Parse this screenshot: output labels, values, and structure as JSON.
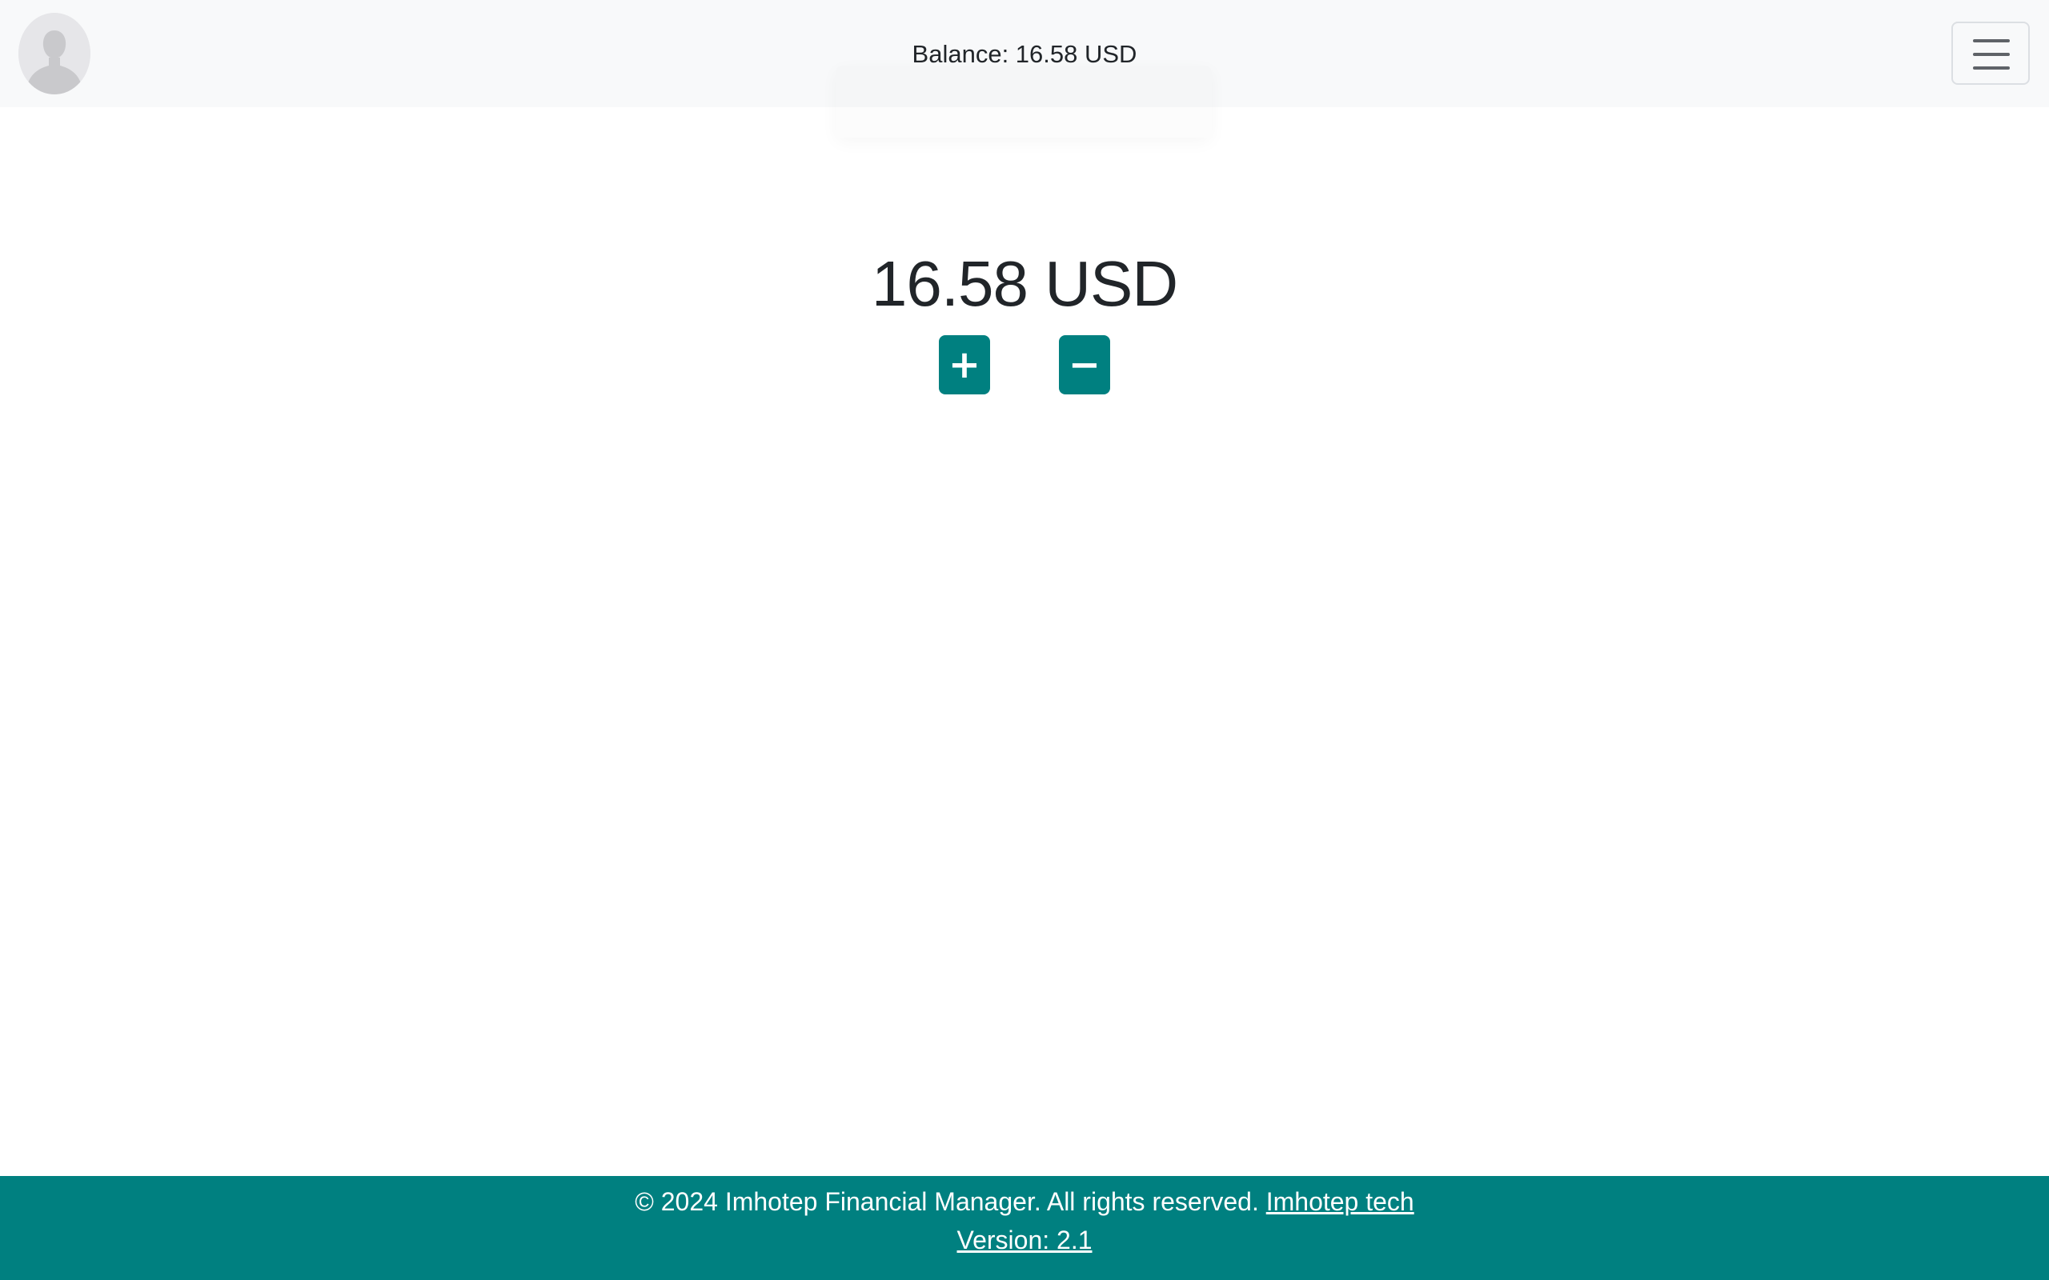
{
  "header": {
    "balance_text": "Balance: 16.58 USD",
    "avatar_icon": "user-silhouette-icon",
    "menu_icon": "hamburger-menu-icon"
  },
  "main": {
    "amount": "16.58 USD",
    "add_label": "+",
    "subtract_label": "−"
  },
  "footer": {
    "copyright": "© 2024 Imhotep Financial Manager. All rights reserved.",
    "company_link": "Imhotep tech",
    "version": "Version: 2.1"
  },
  "colors": {
    "accent": "#008080",
    "navbar_bg": "#f8f9fa"
  }
}
